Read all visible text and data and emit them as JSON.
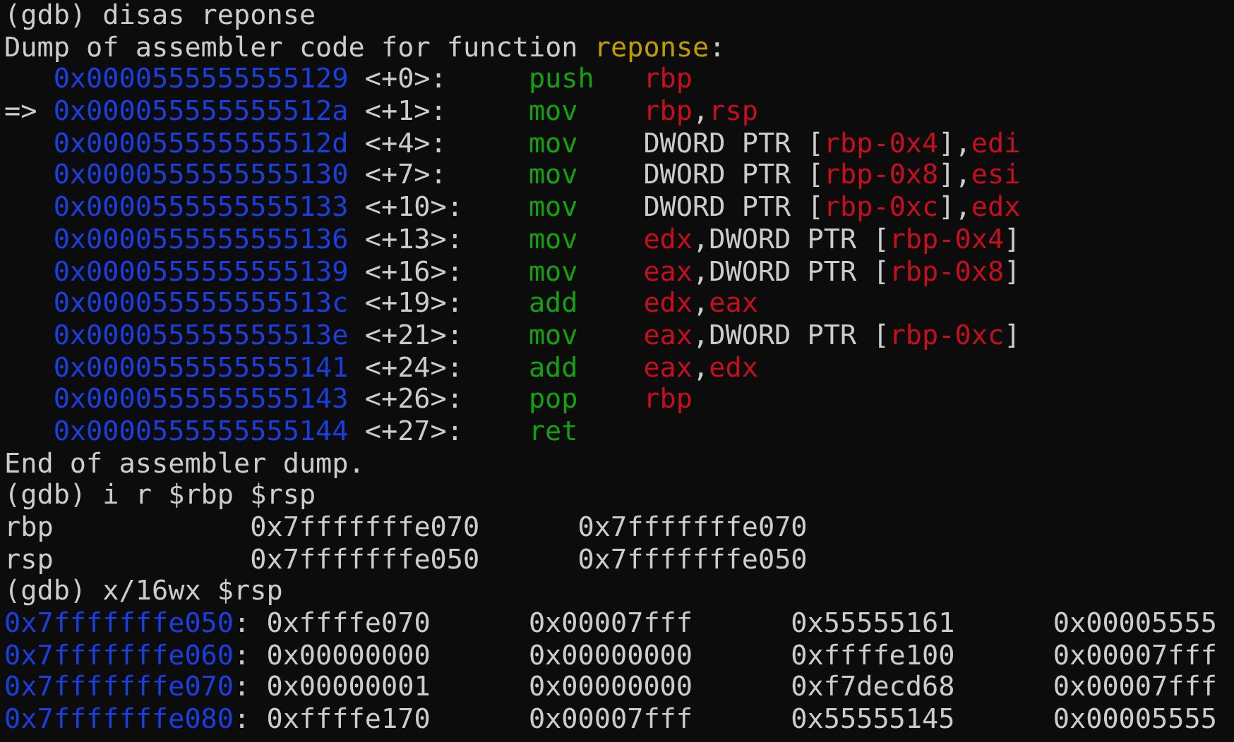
{
  "terminal": {
    "lines": [
      {
        "kind": "text",
        "segments": [
          {
            "text": "(gdb) disas reponse",
            "kind": "plain"
          }
        ]
      },
      {
        "kind": "text",
        "segments": [
          {
            "text": "Dump of assembler code for function ",
            "kind": "plain"
          },
          {
            "text": "reponse",
            "kind": "symbol"
          },
          {
            "text": ":",
            "kind": "plain"
          }
        ]
      },
      {
        "kind": "asm",
        "address": "0x0000555555555129",
        "offset": "<+0>:",
        "mnemonic": "push",
        "operands": [
          {
            "text": "rbp",
            "kind": "register"
          }
        ]
      },
      {
        "kind": "asm",
        "marker": "=>",
        "address": "0x000055555555512a",
        "offset": "<+1>:",
        "mnemonic": "mov",
        "operands": [
          {
            "text": "rbp",
            "kind": "register"
          },
          {
            "text": ",",
            "kind": "plain"
          },
          {
            "text": "rsp",
            "kind": "register"
          }
        ]
      },
      {
        "kind": "asm",
        "address": "0x000055555555512d",
        "offset": "<+4>:",
        "mnemonic": "mov",
        "operands": [
          {
            "text": "DWORD PTR [",
            "kind": "plain"
          },
          {
            "text": "rbp-0x4",
            "kind": "register"
          },
          {
            "text": "],",
            "kind": "plain"
          },
          {
            "text": "edi",
            "kind": "register"
          }
        ]
      },
      {
        "kind": "asm",
        "address": "0x0000555555555130",
        "offset": "<+7>:",
        "mnemonic": "mov",
        "operands": [
          {
            "text": "DWORD PTR [",
            "kind": "plain"
          },
          {
            "text": "rbp-0x8",
            "kind": "register"
          },
          {
            "text": "],",
            "kind": "plain"
          },
          {
            "text": "esi",
            "kind": "register"
          }
        ]
      },
      {
        "kind": "asm",
        "address": "0x0000555555555133",
        "offset": "<+10>:",
        "mnemonic": "mov",
        "operands": [
          {
            "text": "DWORD PTR [",
            "kind": "plain"
          },
          {
            "text": "rbp-0xc",
            "kind": "register"
          },
          {
            "text": "],",
            "kind": "plain"
          },
          {
            "text": "edx",
            "kind": "register"
          }
        ]
      },
      {
        "kind": "asm",
        "address": "0x0000555555555136",
        "offset": "<+13>:",
        "mnemonic": "mov",
        "operands": [
          {
            "text": "edx",
            "kind": "register"
          },
          {
            "text": ",DWORD PTR [",
            "kind": "plain"
          },
          {
            "text": "rbp-0x4",
            "kind": "register"
          },
          {
            "text": "]",
            "kind": "plain"
          }
        ]
      },
      {
        "kind": "asm",
        "address": "0x0000555555555139",
        "offset": "<+16>:",
        "mnemonic": "mov",
        "operands": [
          {
            "text": "eax",
            "kind": "register"
          },
          {
            "text": ",DWORD PTR [",
            "kind": "plain"
          },
          {
            "text": "rbp-0x8",
            "kind": "register"
          },
          {
            "text": "]",
            "kind": "plain"
          }
        ]
      },
      {
        "kind": "asm",
        "address": "0x000055555555513c",
        "offset": "<+19>:",
        "mnemonic": "add",
        "operands": [
          {
            "text": "edx",
            "kind": "register"
          },
          {
            "text": ",",
            "kind": "plain"
          },
          {
            "text": "eax",
            "kind": "register"
          }
        ]
      },
      {
        "kind": "asm",
        "address": "0x000055555555513e",
        "offset": "<+21>:",
        "mnemonic": "mov",
        "operands": [
          {
            "text": "eax",
            "kind": "register"
          },
          {
            "text": ",DWORD PTR [",
            "kind": "plain"
          },
          {
            "text": "rbp-0xc",
            "kind": "register"
          },
          {
            "text": "]",
            "kind": "plain"
          }
        ]
      },
      {
        "kind": "asm",
        "address": "0x0000555555555141",
        "offset": "<+24>:",
        "mnemonic": "add",
        "operands": [
          {
            "text": "eax",
            "kind": "register"
          },
          {
            "text": ",",
            "kind": "plain"
          },
          {
            "text": "edx",
            "kind": "register"
          }
        ]
      },
      {
        "kind": "asm",
        "address": "0x0000555555555143",
        "offset": "<+26>:",
        "mnemonic": "pop",
        "operands": [
          {
            "text": "rbp",
            "kind": "register"
          }
        ]
      },
      {
        "kind": "asm",
        "address": "0x0000555555555144",
        "offset": "<+27>:",
        "mnemonic": "ret"
      },
      {
        "kind": "text",
        "segments": [
          {
            "text": "End of assembler dump.",
            "kind": "plain"
          }
        ]
      },
      {
        "kind": "text",
        "segments": [
          {
            "text": "(gdb) i r $rbp $rsp",
            "kind": "plain"
          }
        ]
      },
      {
        "kind": "register",
        "name": "rbp",
        "hex": "0x7fffffffe070",
        "natural": "0x7fffffffe070"
      },
      {
        "kind": "register",
        "name": "rsp",
        "hex": "0x7fffffffe050",
        "natural": "0x7fffffffe050"
      },
      {
        "kind": "text",
        "segments": [
          {
            "text": "(gdb) x/16wx $rsp",
            "kind": "plain"
          }
        ]
      },
      {
        "kind": "memory",
        "address": "0x7fffffffe050",
        "separator": ":",
        "words": [
          "0xffffe070",
          "0x00007fff",
          "0x55555161",
          "0x00005555"
        ]
      },
      {
        "kind": "memory",
        "address": "0x7fffffffe060",
        "separator": ":",
        "words": [
          "0x00000000",
          "0x00000000",
          "0xffffe100",
          "0x00007fff"
        ]
      },
      {
        "kind": "memory",
        "address": "0x7fffffffe070",
        "separator": ":",
        "words": [
          "0x00000001",
          "0x00000000",
          "0xf7decd68",
          "0x00007fff"
        ]
      },
      {
        "kind": "memory",
        "address": "0x7fffffffe080",
        "separator": ":",
        "words": [
          "0xffffe170",
          "0x00007fff",
          "0x55555145",
          "0x00005555"
        ]
      }
    ]
  }
}
